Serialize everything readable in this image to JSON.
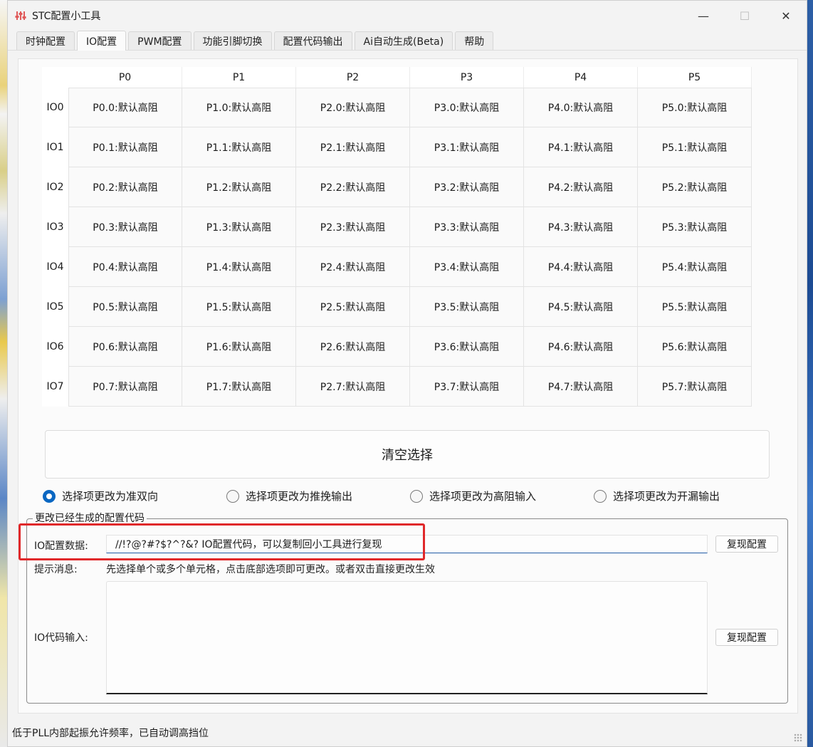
{
  "window": {
    "title": "STC配置小工具",
    "minimize": "—",
    "maximize": "☐",
    "close": "✕"
  },
  "tabs": [
    "时钟配置",
    "IO配置",
    "PWM配置",
    "功能引脚切换",
    "配置代码输出",
    "Ai自动生成(Beta)",
    "帮助"
  ],
  "active_tab": "IO配置",
  "grid": {
    "columns": [
      "P0",
      "P1",
      "P2",
      "P3",
      "P4",
      "P5"
    ],
    "rows": [
      {
        "label": "IO0",
        "cells": [
          "P0.0:默认高阻",
          "P1.0:默认高阻",
          "P2.0:默认高阻",
          "P3.0:默认高阻",
          "P4.0:默认高阻",
          "P5.0:默认高阻"
        ]
      },
      {
        "label": "IO1",
        "cells": [
          "P0.1:默认高阻",
          "P1.1:默认高阻",
          "P2.1:默认高阻",
          "P3.1:默认高阻",
          "P4.1:默认高阻",
          "P5.1:默认高阻"
        ]
      },
      {
        "label": "IO2",
        "cells": [
          "P0.2:默认高阻",
          "P1.2:默认高阻",
          "P2.2:默认高阻",
          "P3.2:默认高阻",
          "P4.2:默认高阻",
          "P5.2:默认高阻"
        ]
      },
      {
        "label": "IO3",
        "cells": [
          "P0.3:默认高阻",
          "P1.3:默认高阻",
          "P2.3:默认高阻",
          "P3.3:默认高阻",
          "P4.3:默认高阻",
          "P5.3:默认高阻"
        ]
      },
      {
        "label": "IO4",
        "cells": [
          "P0.4:默认高阻",
          "P1.4:默认高阻",
          "P2.4:默认高阻",
          "P3.4:默认高阻",
          "P4.4:默认高阻",
          "P5.4:默认高阻"
        ]
      },
      {
        "label": "IO5",
        "cells": [
          "P0.5:默认高阻",
          "P1.5:默认高阻",
          "P2.5:默认高阻",
          "P3.5:默认高阻",
          "P4.5:默认高阻",
          "P5.5:默认高阻"
        ]
      },
      {
        "label": "IO6",
        "cells": [
          "P0.6:默认高阻",
          "P1.6:默认高阻",
          "P2.6:默认高阻",
          "P3.6:默认高阻",
          "P4.6:默认高阻",
          "P5.6:默认高阻"
        ]
      },
      {
        "label": "IO7",
        "cells": [
          "P0.7:默认高阻",
          "P1.7:默认高阻",
          "P2.7:默认高阻",
          "P3.7:默认高阻",
          "P4.7:默认高阻",
          "P5.7:默认高阻"
        ]
      }
    ]
  },
  "clear_button": "清空选择",
  "radios": [
    {
      "label": "选择项更改为准双向",
      "checked": true
    },
    {
      "label": "选择项更改为推挽输出",
      "checked": false
    },
    {
      "label": "选择项更改为高阻输入",
      "checked": false
    },
    {
      "label": "选择项更改为开漏输出",
      "checked": false
    }
  ],
  "group": {
    "legend": "更改已经生成的配置代码",
    "data_label": "IO配置数据:",
    "data_value": "//!?@?#?$?^?&? IO配置代码，可以复制回小工具进行复现",
    "restore_button_1": "复现配置",
    "hint_label": "提示消息:",
    "hint_text": "先选择单个或多个单元格，点击底部选项即可更改。或者双击直接更改生效",
    "code_label": "IO代码输入:",
    "code_value": "",
    "restore_button_2": "复现配置"
  },
  "status": "低于PLL内部起振允许频率，已自动调高挡位",
  "colors": {
    "accent": "#0a67c2",
    "highlight_box": "#e0282a"
  }
}
